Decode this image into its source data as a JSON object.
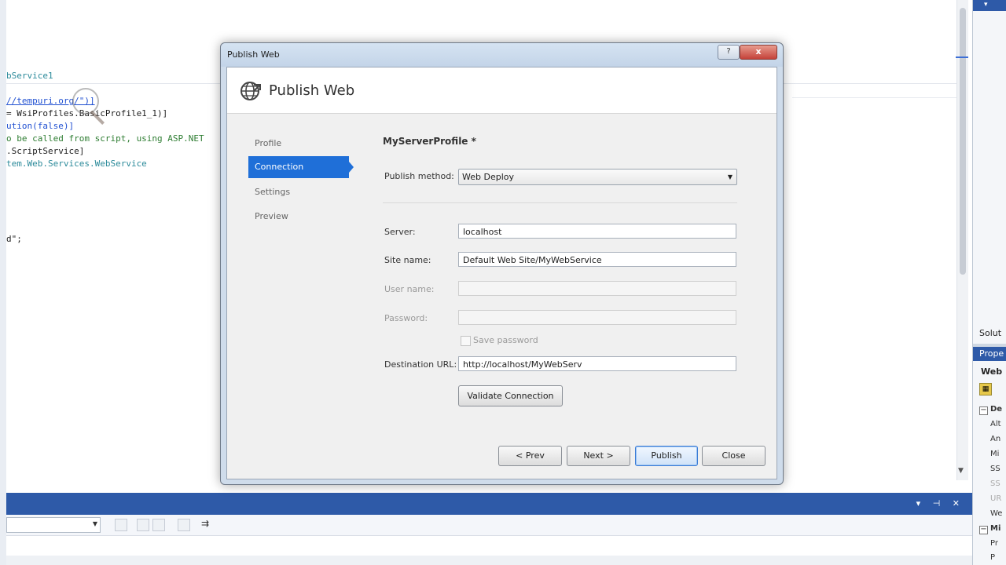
{
  "ide": {
    "code_lines": [
      {
        "text": "bService1",
        "color": "#2b8a9a"
      },
      {
        "text": "//tempuri.org/\")]",
        "color": "#1f4fd1"
      },
      {
        "text": "= WsiProfiles.BasicProfile1_1)]",
        "color": "#222222"
      },
      {
        "text": "ution(false)]",
        "color": "#1f4fd1"
      },
      {
        "text": "o be called from script, using ASP.NET",
        "color": "#2e7d32"
      },
      {
        "text": ".ScriptService]",
        "color": "#222222"
      },
      {
        "text": "tem.Web.Services.WebService",
        "color": "#2b8a9a"
      },
      {
        "text": "d\";",
        "color": "#222222"
      }
    ],
    "right_panel": {
      "solution_label": "Solut",
      "properties_header": "Prope",
      "properties_title": "Web",
      "section_1": "De",
      "props": [
        "Alt",
        "An",
        "Mi",
        "SS",
        "SS",
        "UR",
        "We"
      ],
      "section_2": "Mi",
      "props_2": [
        "Pr",
        "P"
      ]
    }
  },
  "dialog": {
    "window_title": "Publish Web",
    "help_button": "?",
    "close_button": "x",
    "header_title": "Publish Web",
    "nav": {
      "items": [
        "Profile",
        "Connection",
        "Settings",
        "Preview"
      ],
      "active": "Connection"
    },
    "profile_name": "MyServerProfile *",
    "form": {
      "publish_method_label": "Publish method:",
      "publish_method_value": "Web Deploy",
      "server_label": "Server:",
      "server_value": "localhost",
      "site_name_label": "Site name:",
      "site_name_value": "Default Web Site/MyWebService",
      "user_name_label": "User name:",
      "user_name_value": "",
      "password_label": "Password:",
      "password_value": "",
      "save_password_label": "Save password",
      "destination_url_label": "Destination URL:",
      "destination_url_value": "http://localhost/MyWebServ",
      "validate_button": "Validate Connection"
    },
    "buttons": {
      "prev": "< Prev",
      "next": "Next >",
      "publish": "Publish",
      "close": "Close"
    }
  }
}
